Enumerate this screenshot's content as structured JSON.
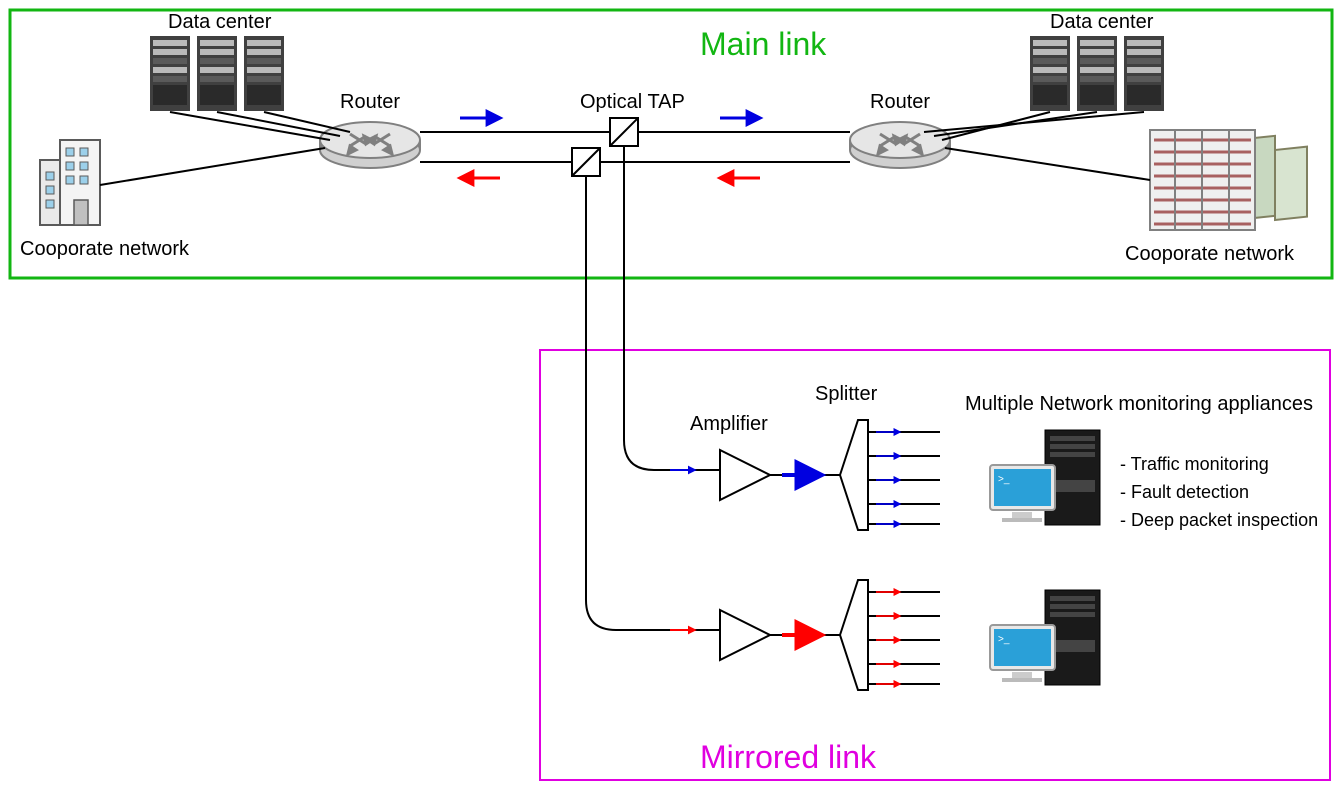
{
  "sections": {
    "main_link": {
      "title": "Main link"
    },
    "mirrored_link": {
      "title": "Mirrored link"
    }
  },
  "labels": {
    "data_center_left": "Data center",
    "data_center_right": "Data center",
    "corporate_left": "Cooporate network",
    "corporate_right": "Cooporate network",
    "router_left": "Router",
    "router_right": "Router",
    "optical_tap": "Optical TAP",
    "amplifier": "Amplifier",
    "splitter": "Splitter",
    "monitoring_title": "Multiple Network monitoring appliances",
    "bullets": [
      "- Traffic monitoring",
      "- Fault detection",
      "- Deep packet inspection"
    ]
  },
  "colors": {
    "main_box": "#12b612",
    "mirror_box": "#e000e0",
    "arrow_blue": "#0000e0",
    "arrow_red": "#ff0000",
    "device_fill": "#d0d0d0",
    "device_stroke": "#808080",
    "server_dark": "#404040",
    "building_line": "#5a5a5a",
    "screen": "#2aa0d8"
  }
}
